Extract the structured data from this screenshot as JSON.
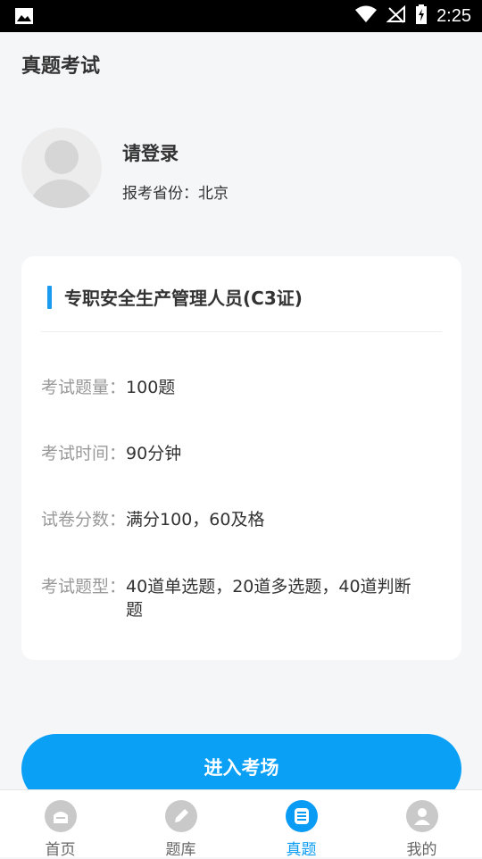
{
  "status_bar": {
    "time": "2:25"
  },
  "header": {
    "title": "真题考试"
  },
  "profile": {
    "login_text": "请登录",
    "province_label": "报考省份：",
    "province_value": "北京"
  },
  "exam_card": {
    "title": "专职安全生产管理人员(C3证)",
    "rows": [
      {
        "label": "考试题量：",
        "value": "100题"
      },
      {
        "label": "考试时间：",
        "value": "90分钟"
      },
      {
        "label": "试卷分数：",
        "value": "满分100，60及格"
      },
      {
        "label": "考试题型：",
        "value": "40道单选题，20道多选题，40道判断题"
      }
    ]
  },
  "enter_button": {
    "label": "进入考场"
  },
  "tabbar": {
    "items": [
      {
        "label": "首页",
        "icon": "home-icon",
        "active": false
      },
      {
        "label": "题库",
        "icon": "pencil-icon",
        "active": false
      },
      {
        "label": "真题",
        "icon": "document-icon",
        "active": true
      },
      {
        "label": "我的",
        "icon": "user-icon",
        "active": false
      }
    ]
  },
  "colors": {
    "accent": "#0a9cf4",
    "background": "#f5f6f8",
    "card": "#ffffff",
    "inactive_icon": "#c9c9c9"
  }
}
